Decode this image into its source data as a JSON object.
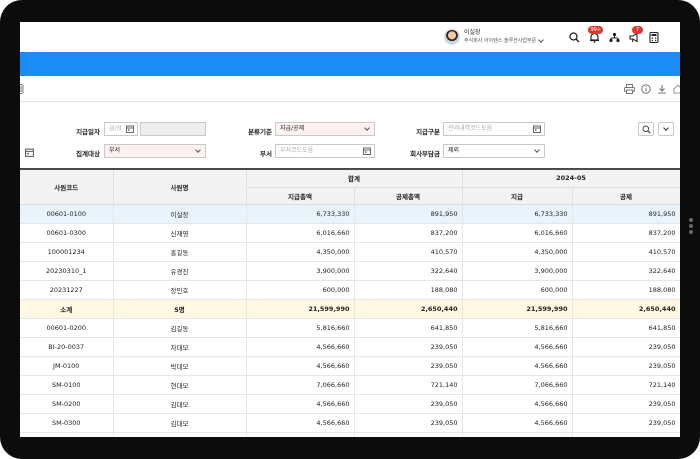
{
  "header": {
    "user_name": "이실장",
    "user_org": "주식회사 아이텐스 솔루션사업부문",
    "notification_badge": "99+",
    "announce_badge": "7"
  },
  "filters": {
    "pay_date_label": "지급일자",
    "pay_date_placeholder": "급/상",
    "category_label": "분류기준",
    "category_value": "지급/공제",
    "pay_type_label": "지급구분",
    "pay_type_placeholder": "관리내역코드도움",
    "agg_target_label": "집계대상",
    "agg_target_value": "부서",
    "dept_label": "부서",
    "dept_placeholder": "부서코드도움",
    "company_share_label": "회사부담금",
    "company_share_value": "제외"
  },
  "table": {
    "col_emp_code": "사원코드",
    "col_emp_name": "사원명",
    "group_total": "합계",
    "group_month": "2024-05",
    "col_pay_total": "지급총액",
    "col_deduct_total": "공제총액",
    "col_pay": "지급",
    "col_deduct": "공제",
    "rows": [
      {
        "code": "00601-0100",
        "name": "이실장",
        "pay_total": "6,733,330",
        "deduct_total": "891,950",
        "pay": "6,733,330",
        "deduct": "891,950",
        "kind": "sel"
      },
      {
        "code": "00601-0300",
        "name": "신재영",
        "pay_total": "6,016,660",
        "deduct_total": "837,200",
        "pay": "6,016,660",
        "deduct": "837,200",
        "kind": ""
      },
      {
        "code": "100001234",
        "name": "홍길동",
        "pay_total": "4,350,000",
        "deduct_total": "410,570",
        "pay": "4,350,000",
        "deduct": "410,570",
        "kind": ""
      },
      {
        "code": "20230310_1",
        "name": "유경진",
        "pay_total": "3,900,000",
        "deduct_total": "322,640",
        "pay": "3,900,000",
        "deduct": "322,640",
        "kind": ""
      },
      {
        "code": "20231227",
        "name": "장민호",
        "pay_total": "600,000",
        "deduct_total": "188,080",
        "pay": "600,000",
        "deduct": "188,080",
        "kind": ""
      },
      {
        "code": "소계",
        "name": "5명",
        "pay_total": "21,599,990",
        "deduct_total": "2,650,440",
        "pay": "21,599,990",
        "deduct": "2,650,440",
        "kind": "sub"
      },
      {
        "code": "00601-0200",
        "name": "김길동",
        "pay_total": "5,816,660",
        "deduct_total": "641,850",
        "pay": "5,816,660",
        "deduct": "641,850",
        "kind": ""
      },
      {
        "code": "BI-20-0037",
        "name": "차대모",
        "pay_total": "4,566,660",
        "deduct_total": "239,050",
        "pay": "4,566,660",
        "deduct": "239,050",
        "kind": ""
      },
      {
        "code": "JM-0100",
        "name": "박대모",
        "pay_total": "4,566,660",
        "deduct_total": "239,050",
        "pay": "4,566,660",
        "deduct": "239,050",
        "kind": ""
      },
      {
        "code": "SM-0100",
        "name": "현대모",
        "pay_total": "7,066,660",
        "deduct_total": "721,140",
        "pay": "7,066,660",
        "deduct": "721,140",
        "kind": ""
      },
      {
        "code": "SM-0200",
        "name": "김대모",
        "pay_total": "4,566,660",
        "deduct_total": "239,050",
        "pay": "4,566,660",
        "deduct": "239,050",
        "kind": ""
      },
      {
        "code": "SM-0300",
        "name": "김대모",
        "pay_total": "4,566,660",
        "deduct_total": "239,050",
        "pay": "4,566,660",
        "deduct": "239,050",
        "kind": ""
      },
      {
        "code": "",
        "name": "",
        "pay_total": "",
        "deduct_total": "",
        "pay": "",
        "deduct": "",
        "kind": ""
      }
    ]
  },
  "colors": {
    "accent": "#1c8cf5",
    "selected_row": "#e9f3fc",
    "subtotal_row": "#fff8e2",
    "required_field": "#fdf1f1"
  }
}
